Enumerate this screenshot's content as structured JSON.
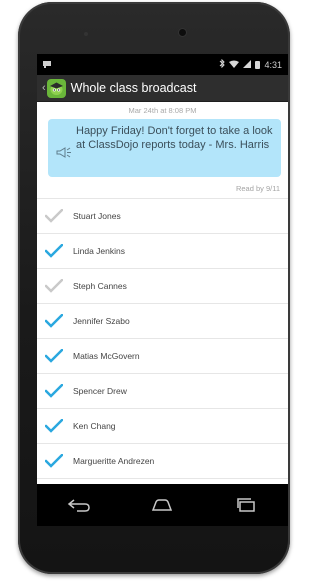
{
  "status": {
    "time": "4:31"
  },
  "header": {
    "title": "Whole class broadcast"
  },
  "message": {
    "timestamp": "Mar 24th at 8:08 PM",
    "text": "Happy Friday! Don't forget to take a look at ClassDojo reports today - Mrs. Harris",
    "read_by": "Read by 9/11"
  },
  "recipients": [
    {
      "name": "Stuart Jones",
      "read": false
    },
    {
      "name": "Linda Jenkins",
      "read": true
    },
    {
      "name": "Steph Cannes",
      "read": false
    },
    {
      "name": "Jennifer Szabo",
      "read": true
    },
    {
      "name": "Matias McGovern",
      "read": true
    },
    {
      "name": "Spencer Drew",
      "read": true
    },
    {
      "name": "Ken Chang",
      "read": true
    },
    {
      "name": "Margueritte Andrezen",
      "read": true
    }
  ],
  "colors": {
    "check_read": "#2aa8df",
    "check_unread": "#c9c9c9",
    "bubble": "#b3e5fa",
    "actionbar": "#2e2e2e"
  },
  "icons": {
    "status": [
      "notification-icon",
      "bluetooth-icon",
      "wifi-icon",
      "signal-icon",
      "battery-icon"
    ],
    "nav": [
      "back-icon",
      "home-icon",
      "recents-icon"
    ]
  }
}
